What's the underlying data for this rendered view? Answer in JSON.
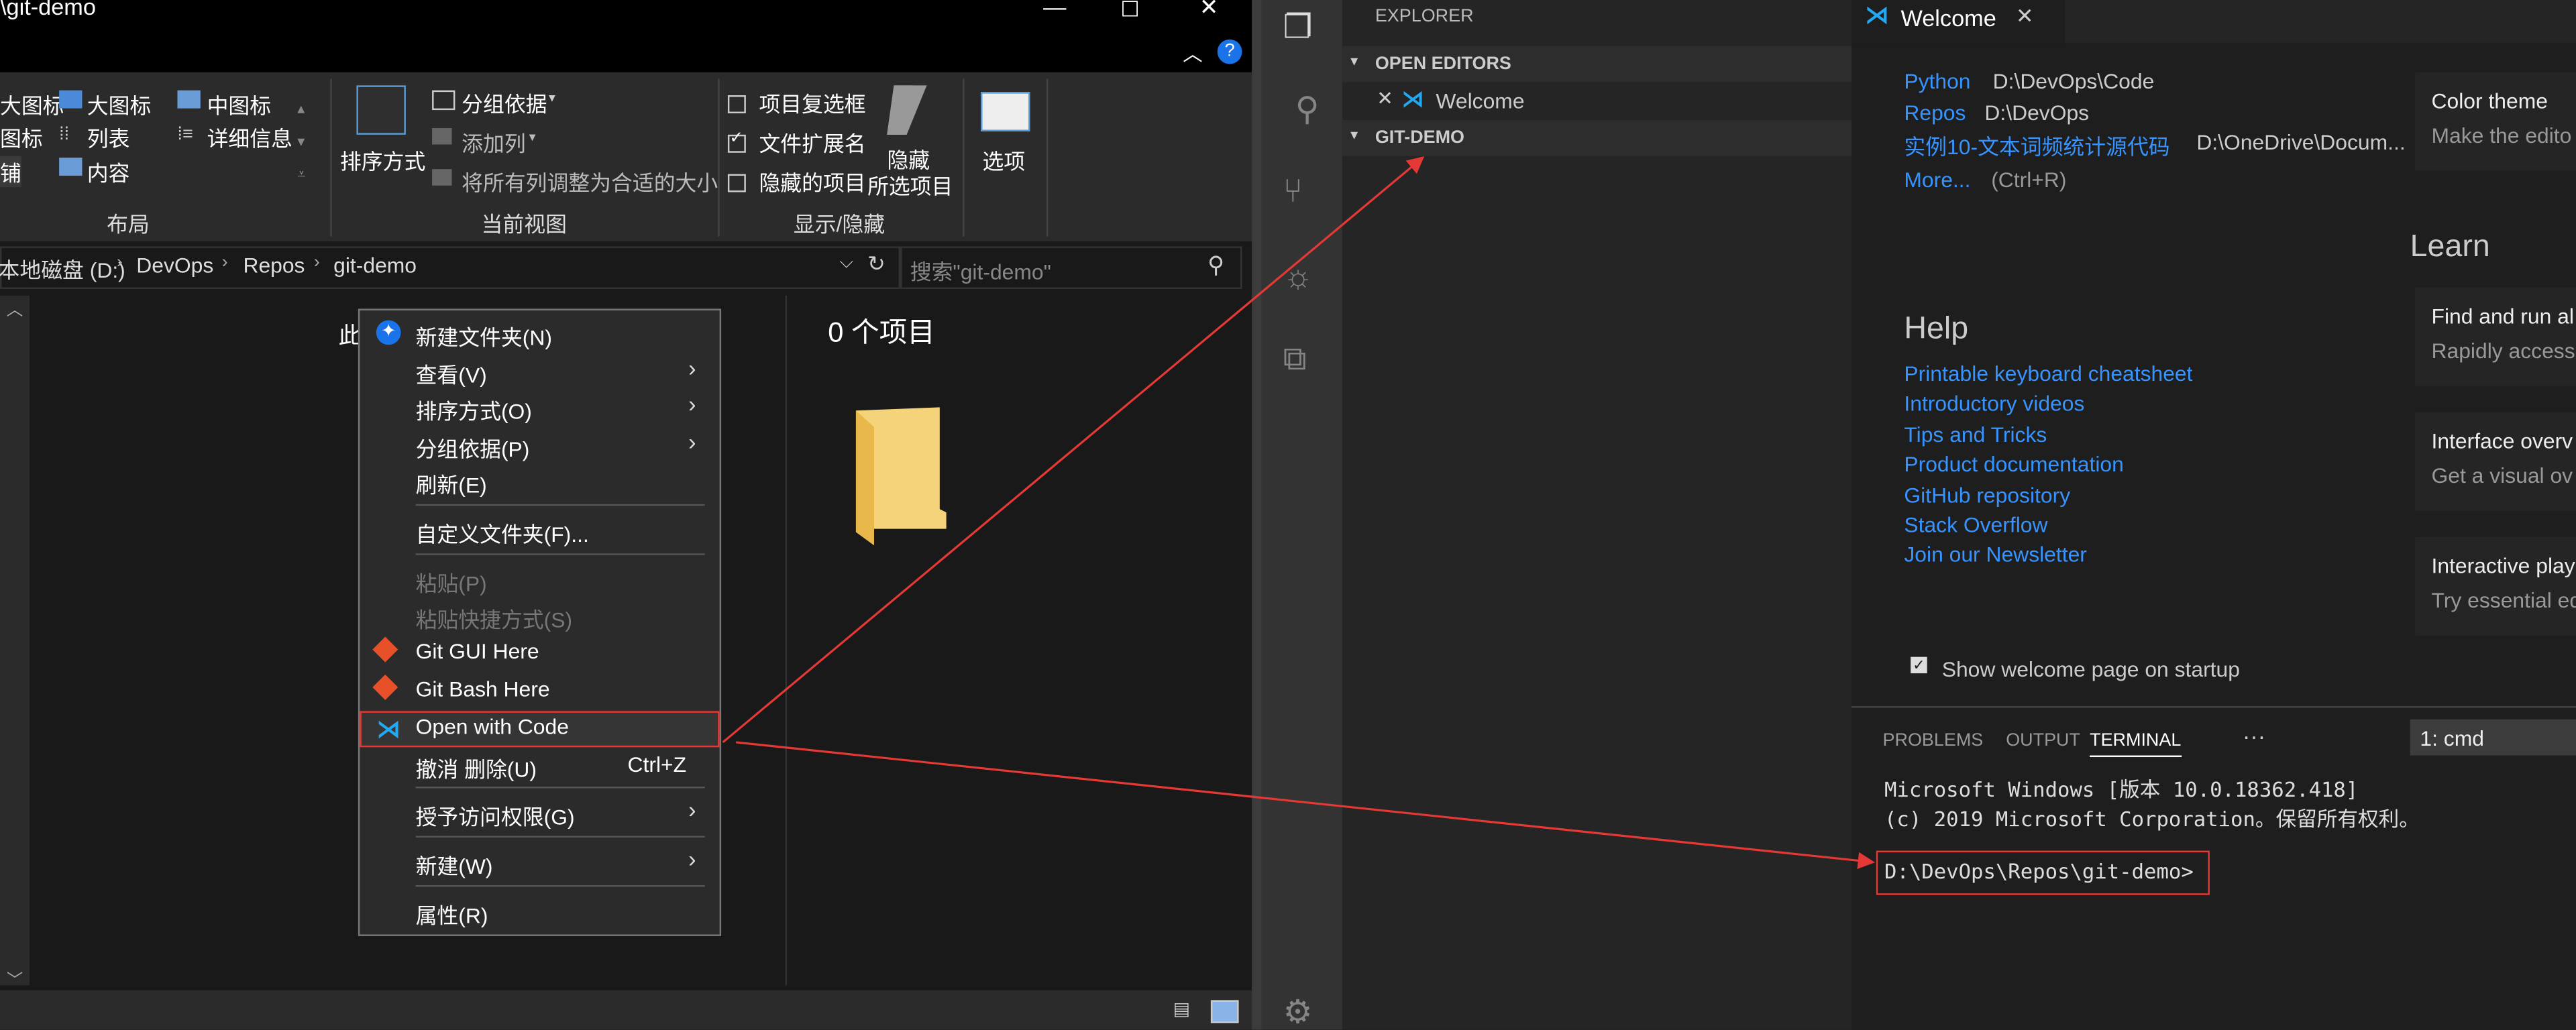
{
  "explorer": {
    "title": "\\git-demo",
    "ribbon": {
      "layout_items": [
        "大图标",
        "大图标",
        "中图标",
        "图标",
        "列表",
        "详细信息",
        "铺",
        "内容"
      ],
      "sort_label": "排序方式",
      "group_by": "分组依据",
      "add_column": "添加列",
      "fit_columns": "将所有列调整为合适的大小",
      "item_checkboxes": "项目复选框",
      "file_extensions": "文件扩展名",
      "hidden_items": "隐藏的项目",
      "hide_selected_1": "隐藏",
      "hide_selected_2": "所选项目",
      "options": "选项",
      "group_layout": "布局",
      "group_current_view": "当前视图",
      "group_show_hide": "显示/隐藏"
    },
    "address": [
      "本地磁盘 (D:)",
      "DevOps",
      "Repos",
      "git-demo"
    ],
    "search_placeholder": "搜索\"git-demo\"",
    "item_count": "0 个项目",
    "left_text": "此",
    "context_menu": {
      "new_folder": "新建文件夹(N)",
      "view": "查看(V)",
      "sort": "排序方式(O)",
      "group": "分组依据(P)",
      "refresh": "刷新(E)",
      "customize": "自定义文件夹(F)...",
      "paste": "粘贴(P)",
      "paste_shortcut": "粘贴快捷方式(S)",
      "git_gui": "Git GUI Here",
      "git_bash": "Git Bash Here",
      "open_code": "Open with Code",
      "undo": "撤消 删除(U)",
      "undo_shortcut": "Ctrl+Z",
      "grant_access": "授予访问权限(G)",
      "new": "新建(W)",
      "properties": "属性(R)"
    }
  },
  "vscode": {
    "sidebar_title": "EXPLORER",
    "open_editors": "OPEN EDITORS",
    "open_file": "Welcome",
    "folder": "GIT-DEMO",
    "tab": "Welcome",
    "recent": [
      {
        "name": "Python",
        "path": "D:\\DevOps\\Code"
      },
      {
        "name": "Repos",
        "path": "D:\\DevOps"
      },
      {
        "name": "实例10-文本词频统计源代码",
        "path": "D:\\OneDrive\\Docum..."
      }
    ],
    "more": "More...",
    "more_shortcut": "(Ctrl+R)",
    "help_title": "Help",
    "help_links": [
      "Printable keyboard cheatsheet",
      "Introductory videos",
      "Tips and Tricks",
      "Product documentation",
      "GitHub repository",
      "Stack Overflow",
      "Join our Newsletter"
    ],
    "show_welcome": "Show welcome page on startup",
    "learn_title": "Learn",
    "cards": [
      {
        "title": "Color theme",
        "desc": "Make the edito"
      },
      {
        "title": "Find and run al",
        "desc": "Rapidly access"
      },
      {
        "title": "Interface overv",
        "desc": "Get a visual ov"
      },
      {
        "title": "Interactive play",
        "desc": "Try essential ed"
      }
    ],
    "panel_tabs": [
      "PROBLEMS",
      "OUTPUT",
      "TERMINAL",
      "···"
    ],
    "terminal_select": "1: cmd",
    "terminal_lines": [
      "Microsoft Windows [版本 10.0.18362.418]",
      "(c) 2019 Microsoft Corporation。保留所有权利。"
    ],
    "prompt": "D:\\DevOps\\Repos\\git-demo>"
  },
  "colors": {
    "annotation": "#e53935",
    "link": "#3794ff",
    "vscode_blue": "#23a9f2"
  }
}
